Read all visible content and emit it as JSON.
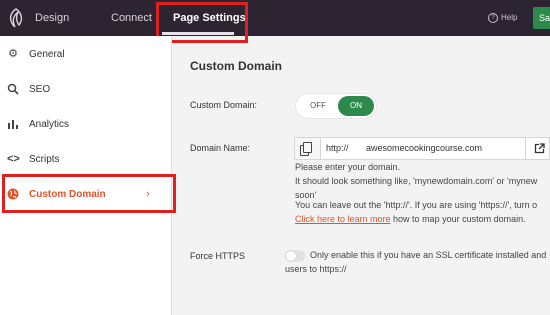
{
  "topbar": {
    "tabs": [
      {
        "label": "Design"
      },
      {
        "label": "Connect"
      },
      {
        "label": "Page Settings",
        "active": true
      }
    ],
    "help_label": "Help",
    "save_label": "Sav"
  },
  "sidebar": {
    "items": [
      {
        "label": "General",
        "icon": "gear-icon"
      },
      {
        "label": "SEO",
        "icon": "search-icon"
      },
      {
        "label": "Analytics",
        "icon": "bar-chart-icon"
      },
      {
        "label": "Scripts",
        "icon": "code-icon"
      },
      {
        "label": "Custom Domain",
        "icon": "globe-icon",
        "active": true
      }
    ],
    "active_chevron": "›"
  },
  "main": {
    "title": "Custom Domain",
    "custom_domain": {
      "label": "Custom Domain:",
      "off_label": "OFF",
      "on_label": "ON",
      "value": "ON"
    },
    "domain_name": {
      "label": "Domain Name:",
      "prefix": "http://",
      "value": "awesomecookingcourse.com",
      "help": [
        "Please enter your domain.",
        "It should look something like, 'mynewdomain.com' or 'mynew",
        "soon'",
        "You can leave out the 'http://'. If you are using 'https://', turn o"
      ],
      "learn_more_link": "Click here to learn more",
      "learn_more_rest": " how to map your custom domain."
    },
    "force_https": {
      "label": "Force HTTPS",
      "enabled": false,
      "help_line1": "Only enable this if you have an SSL certificate installed and",
      "help_line2": "users to https://"
    }
  },
  "colors": {
    "topbar_bg": "#2c2430",
    "accent_orange": "#e2532c",
    "accent_green": "#2e8a4c",
    "highlight_red": "#e02020"
  }
}
